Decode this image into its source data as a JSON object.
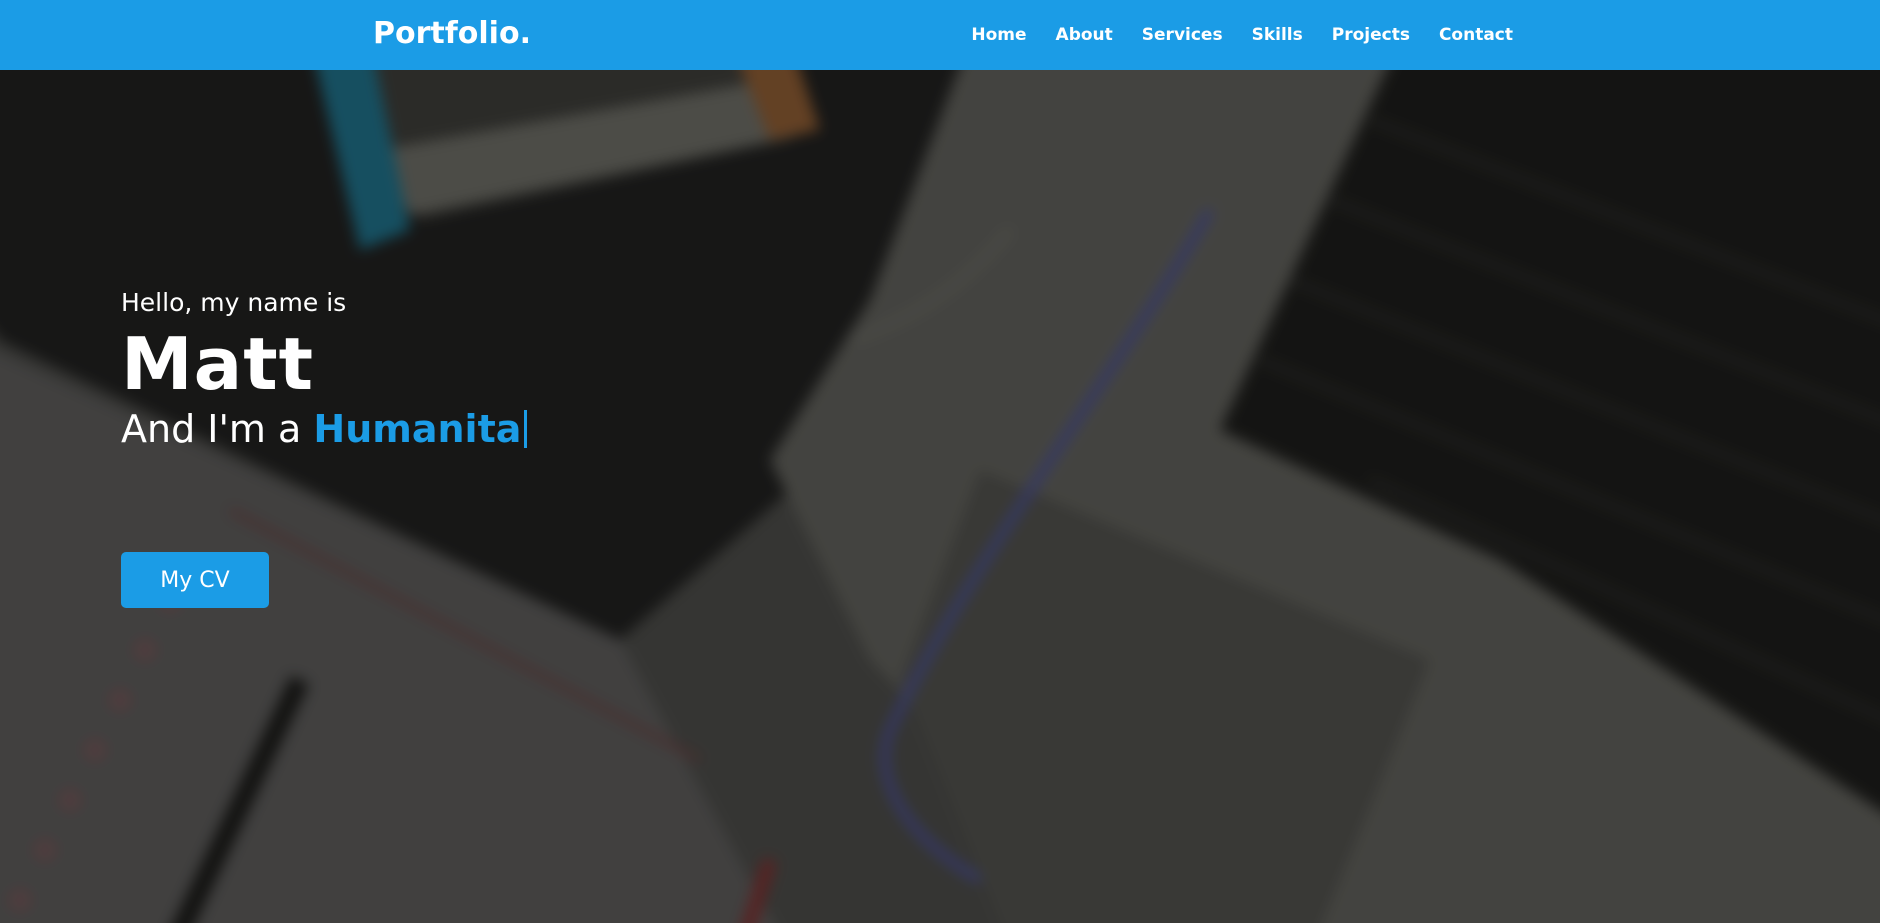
{
  "navbar": {
    "brand": "Portfolio.",
    "links": [
      {
        "label": "Home"
      },
      {
        "label": "About"
      },
      {
        "label": "Services"
      },
      {
        "label": "Skills"
      },
      {
        "label": "Projects"
      },
      {
        "label": "Contact"
      }
    ]
  },
  "hero": {
    "greeting": "Hello, my name is",
    "name": "Matt",
    "role_prefix": "And I'm a ",
    "role_typed": "Humanita",
    "cv_button": "My CV"
  },
  "colors": {
    "accent": "#1b9ce6",
    "navbar_bg": "#1b9ce6",
    "text": "#ffffff"
  }
}
